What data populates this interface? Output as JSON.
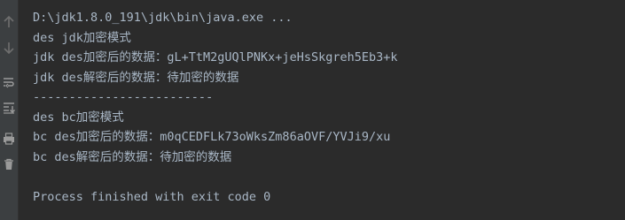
{
  "console": {
    "command": "D:\\jdk1.8.0_191\\jdk\\bin\\java.exe ...",
    "lines": [
      "des jdk加密模式",
      "jdk des加密后的数据：gL+TtM2gUQlPNKx+jeHsSkgreh5Eb3+k",
      "jdk des解密后的数据：待加密的数据",
      "-------------------------",
      "des bc加密模式",
      "bc des加密后的数据：m0qCEDFLk73oWksZm86aOVF/YVJi9/xu",
      "bc des解密后的数据：待加密的数据"
    ],
    "exit_message": "Process finished with exit code 0"
  },
  "gutter": {
    "icons": [
      "arrow-up-icon",
      "arrow-down-icon",
      "soft-wrap-icon",
      "scroll-to-end-icon",
      "print-icon",
      "trash-icon"
    ]
  }
}
